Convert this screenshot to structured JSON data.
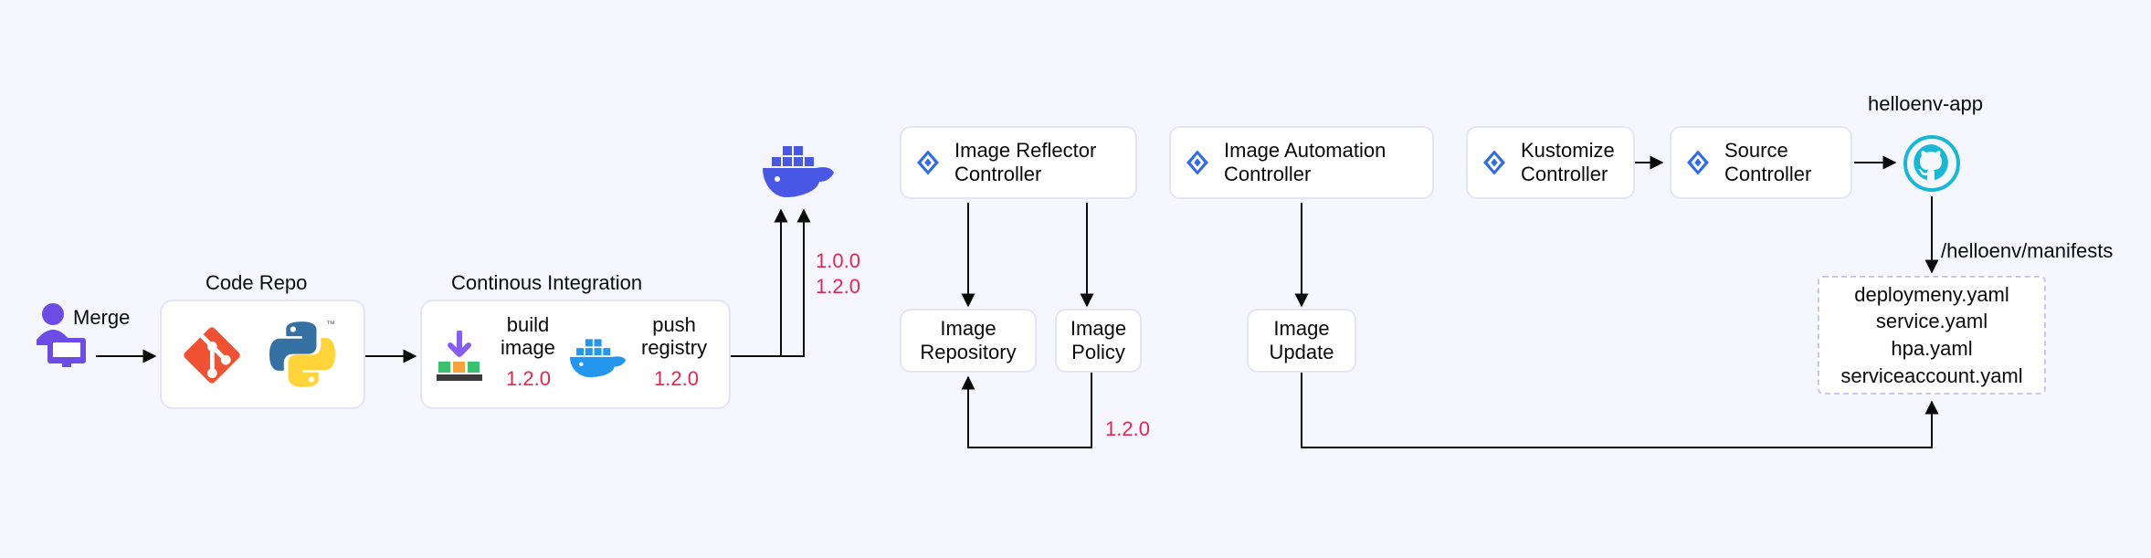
{
  "user_label": "Merge",
  "code_repo": {
    "title": "Code Repo"
  },
  "ci": {
    "title": "Continous Integration",
    "build_label": "build\nimage",
    "build_version": "1.2.0",
    "push_label": "push\nregistry",
    "push_version": "1.2.0"
  },
  "docker_versions": "1.0.0\n1.2.0",
  "controllers": {
    "reflector": "Image Reflector\nController",
    "automation": "Image Automation\nController",
    "kustomize": "Kustomize\nController",
    "source": "Source\nController"
  },
  "subcards": {
    "repo": "Image\nRepository",
    "policy": "Image\nPolicy",
    "update": "Image\nUpdate"
  },
  "policy_version": "1.2.0",
  "app_name": "helloenv-app",
  "manifests_path": "/helloenv/manifests",
  "manifests": {
    "a": "deploymeny.yaml",
    "b": "service.yaml",
    "c": "hpa.yaml",
    "d": "serviceaccount.yaml"
  }
}
